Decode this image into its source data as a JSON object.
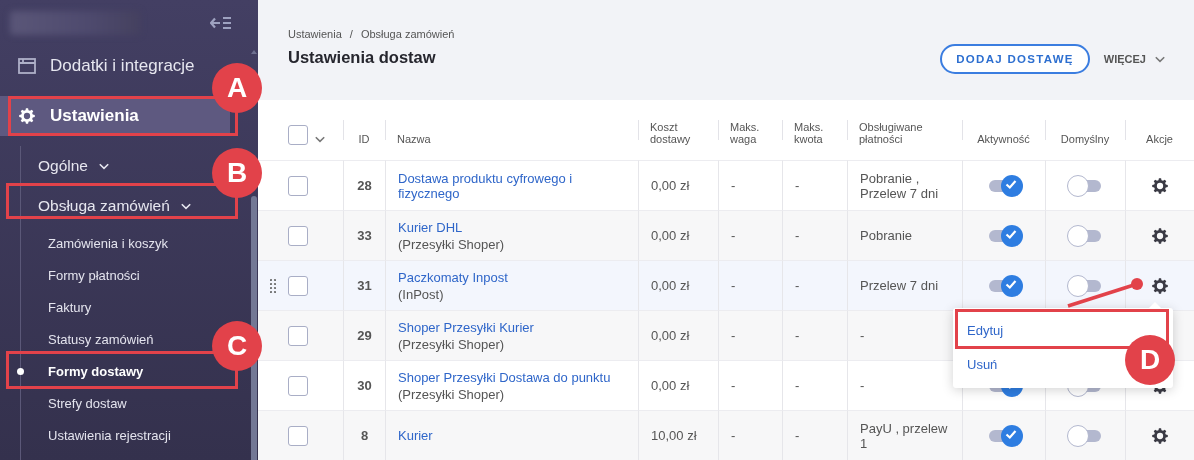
{
  "sidebar": {
    "nav": [
      {
        "label": "Dodatki i integracje",
        "selected": false
      },
      {
        "label": "Ustawienia",
        "selected": true,
        "children": [
          {
            "label": "Ogólne"
          },
          {
            "label": "Obsługa zamówień",
            "children": [
              {
                "label": "Zamówienia i koszyk",
                "selected": false
              },
              {
                "label": "Formy płatności",
                "selected": false
              },
              {
                "label": "Faktury",
                "selected": false
              },
              {
                "label": "Statusy zamówień",
                "selected": false
              },
              {
                "label": "Formy dostawy",
                "selected": true
              },
              {
                "label": "Strefy dostaw",
                "selected": false
              },
              {
                "label": "Ustawienia rejestracji",
                "selected": false
              }
            ]
          }
        ]
      }
    ]
  },
  "header": {
    "breadcrumbs": [
      "Ustawienia",
      "Obsługa zamówień"
    ],
    "breadcrumb_separator": "/",
    "title": "Ustawienia dostaw",
    "primary_button": "DODAJ DOSTAWĘ",
    "more_button": "WIĘCEJ"
  },
  "table": {
    "select_all": {
      "checked": false
    },
    "columns": [
      "ID",
      "Nazwa",
      "Koszt dostawy",
      "Maks. waga",
      "Maks. kwota",
      "Obsługiwane płatności",
      "Aktywność",
      "Domyślny",
      "Akcje"
    ],
    "rows": [
      {
        "checked": false,
        "hovered": false,
        "id": "28",
        "name": "Dostawa produktu cyfrowego i fizycznego",
        "cost": "0,00 zł",
        "max_weight": "-",
        "max_amount": "-",
        "payments": "Pobranie , Przelew 7 dni",
        "active": true,
        "default": false
      },
      {
        "checked": false,
        "hovered": false,
        "id": "33",
        "name": "Kurier DHL",
        "provider": "(Przesyłki Shoper)",
        "cost": "0,00 zł",
        "max_weight": "-",
        "max_amount": "-",
        "payments": "Pobranie",
        "active": true,
        "default": false
      },
      {
        "checked": false,
        "hovered": true,
        "id": "31",
        "name": "Paczkomaty Inpost",
        "provider": "(InPost)",
        "cost": "0,00 zł",
        "max_weight": "-",
        "max_amount": "-",
        "payments": "Przelew 7 dni",
        "active": true,
        "default": false
      },
      {
        "checked": false,
        "hovered": false,
        "id": "29",
        "name": "Shoper Przesyłki Kurier",
        "provider": "(Przesyłki Shoper)",
        "cost": "0,00 zł",
        "max_weight": "-",
        "max_amount": "-",
        "payments": "-"
      },
      {
        "checked": false,
        "hovered": false,
        "id": "30",
        "name": "Shoper Przesyłki Dostawa do punktu",
        "provider": "(Przesyłki Shoper)",
        "cost": "0,00 zł",
        "max_weight": "-",
        "max_amount": "-",
        "payments": "-",
        "active": true,
        "default": false
      },
      {
        "checked": false,
        "hovered": false,
        "id": "8",
        "name": "Kurier",
        "cost": "10,00 zł",
        "max_weight": "-",
        "max_amount": "-",
        "payments": "PayU , przelew 1",
        "active": true,
        "default": false
      }
    ]
  },
  "action_menu": {
    "items": [
      "Edytuj",
      "Usuń"
    ]
  },
  "annotations": [
    {
      "label": "A"
    },
    {
      "label": "B"
    },
    {
      "label": "C"
    },
    {
      "label": "D"
    }
  ]
}
